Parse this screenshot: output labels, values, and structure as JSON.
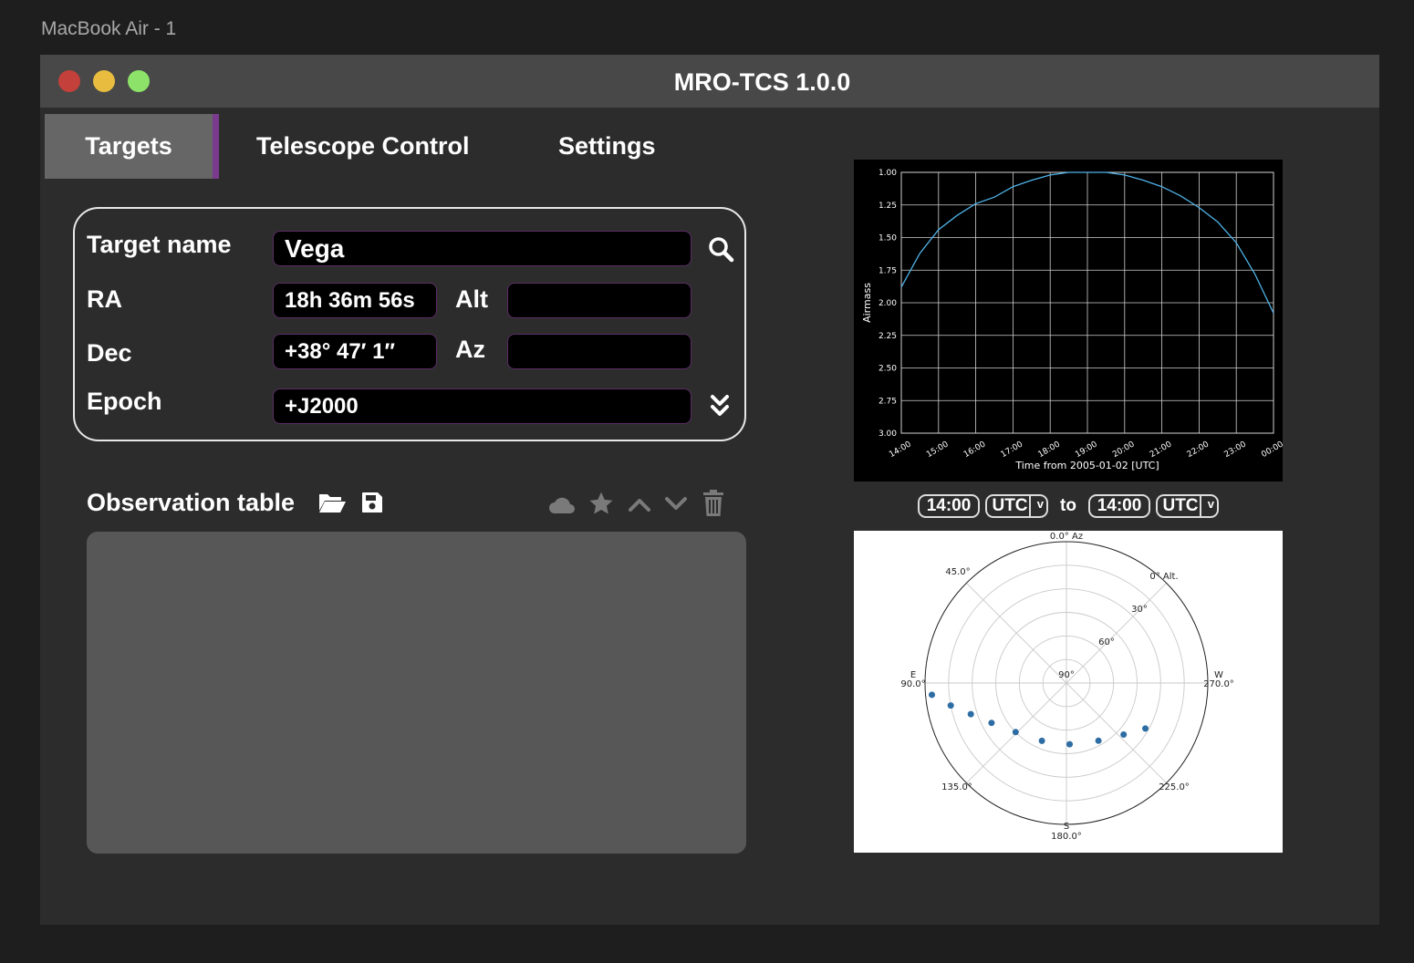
{
  "frame_label": "MacBook Air - 1",
  "window": {
    "title": "MRO-TCS 1.0.0"
  },
  "tabs": [
    {
      "label": "Targets",
      "active": true
    },
    {
      "label": "Telescope Control",
      "active": false
    },
    {
      "label": "Settings",
      "active": false
    }
  ],
  "target": {
    "name_label": "Target name",
    "name_value": "Vega",
    "ra_label": "RA",
    "ra_value": "18h 36m 56s",
    "dec_label": "Dec",
    "dec_value": "+38° 47′ 1″",
    "alt_label": "Alt",
    "alt_value": "",
    "az_label": "Az",
    "az_value": "",
    "epoch_label": "Epoch",
    "epoch_value": "+J2000"
  },
  "observation": {
    "title": "Observation table"
  },
  "time_range": {
    "from_time": "14:00",
    "from_tz": "UTC",
    "to_label": "to",
    "to_time": "14:00",
    "to_tz": "UTC"
  },
  "colors": {
    "accent_purple": "#7a3b8f",
    "series_blue": "#4fb3e8",
    "point_blue": "#2e6da4"
  },
  "icons": [
    "search-icon",
    "double-chevron-down-icon",
    "folder-open-icon",
    "save-icon",
    "cloud-icon",
    "star-icon",
    "chevron-up-icon",
    "chevron-down-icon",
    "trash-icon"
  ],
  "chart_data": [
    {
      "type": "line",
      "xlabel": "Time from 2005-01-02 [UTC]",
      "ylabel": "Airmass",
      "x": [
        "14:00",
        "15:00",
        "16:00",
        "17:00",
        "18:00",
        "19:00",
        "20:00",
        "21:00",
        "22:00",
        "23:00",
        "00:00"
      ],
      "yticks": [
        "1.00",
        "1.25",
        "1.50",
        "1.75",
        "2.00",
        "2.25",
        "2.50",
        "2.75",
        "3.00"
      ],
      "ylim": [
        3.0,
        1.0
      ],
      "grid": true,
      "series": [
        {
          "values": [
            1.88,
            1.62,
            1.44,
            1.33,
            1.24,
            1.19,
            1.11,
            1.06,
            1.02,
            1.0,
            1.0,
            1.0,
            1.02,
            1.06,
            1.11,
            1.18,
            1.27,
            1.38,
            1.54,
            1.78,
            2.08
          ]
        }
      ]
    },
    {
      "type": "scatter",
      "projection": "polar",
      "angle_labels": [
        {
          "text": "0.0° Az"
        },
        {
          "text": "45.0°"
        },
        {
          "text": "E"
        },
        {
          "text": "90.0°"
        },
        {
          "text": "135.0°"
        },
        {
          "text": "S"
        },
        {
          "text": "180.0°"
        },
        {
          "text": "225.0°"
        },
        {
          "text": "W"
        },
        {
          "text": "270.0°"
        }
      ],
      "radial_labels": [
        "0° Alt.",
        "30°",
        "60°",
        "90°"
      ],
      "points": [
        {
          "az": 95,
          "alt": 4
        },
        {
          "az": 101,
          "alt": 15
        },
        {
          "az": 108,
          "alt": 26
        },
        {
          "az": 118,
          "alt": 36
        },
        {
          "az": 134,
          "alt": 45
        },
        {
          "az": 157,
          "alt": 50
        },
        {
          "az": 183,
          "alt": 51
        },
        {
          "az": 209,
          "alt": 48
        },
        {
          "az": 228,
          "alt": 41
        },
        {
          "az": 240,
          "alt": 32
        }
      ]
    }
  ]
}
